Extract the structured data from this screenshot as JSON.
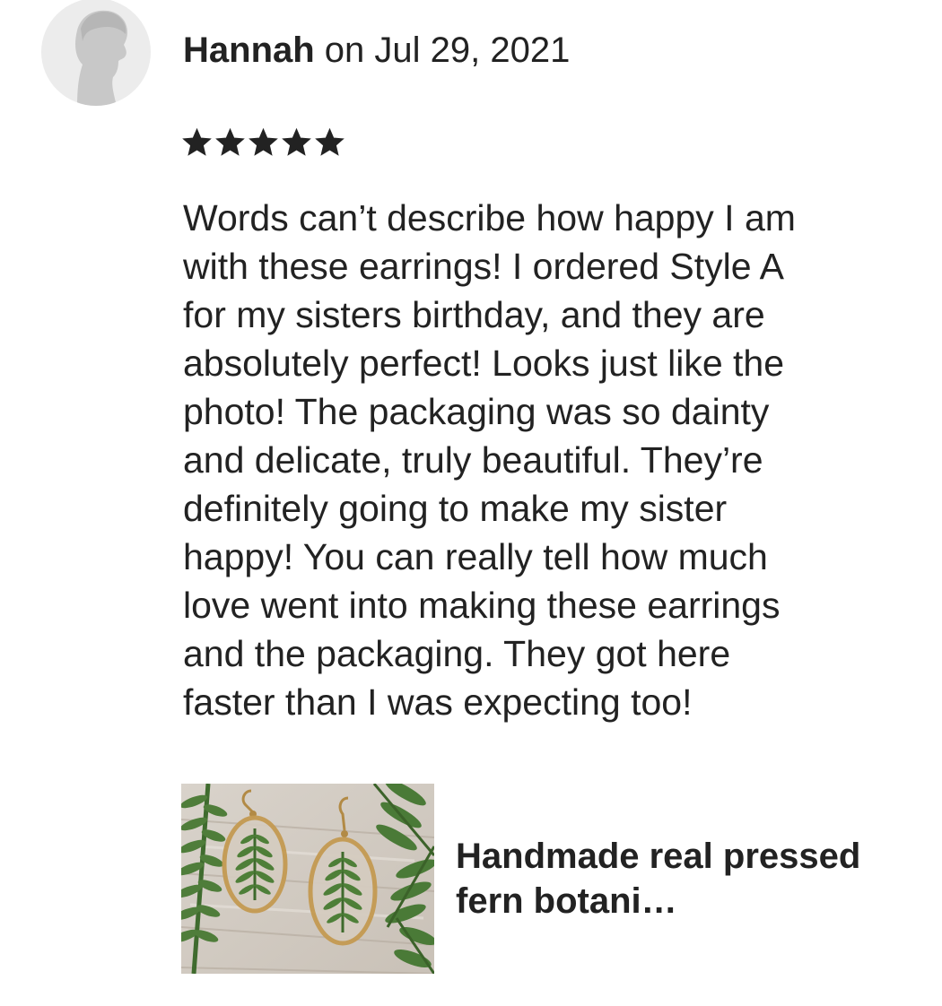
{
  "review": {
    "reviewer_name": "Hannah",
    "date_text": " on Jul 29, 2021",
    "rating": 5,
    "max_rating": 5,
    "text": "Words can’t describe how happy I am\nwith these earrings! I ordered Style A\nfor my sisters birthday, and they are\nabsolutely perfect! Looks just like the\nphoto! The packaging was so dainty\nand delicate, truly beautiful. They’re\ndefinitely going to make my sister\nhappy! You can really tell how much\nlove went into making these earrings\nand the packaging. They got here\nfaster than I was expecting too!"
  },
  "product": {
    "title": "Handmade real pressed fern botani…",
    "image_icon": "fern-earrings-photo"
  },
  "icons": {
    "avatar": "default-user-avatar-icon",
    "star": "star-icon"
  },
  "colors": {
    "text": "#222222",
    "star": "#222222",
    "avatar_bg": "#ececec",
    "avatar_silhouette": "#c8c8c8"
  }
}
